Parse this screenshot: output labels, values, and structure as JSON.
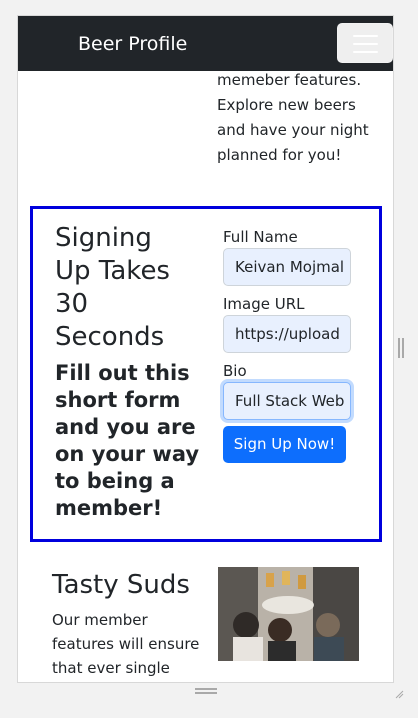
{
  "navbar": {
    "brand": "Beer Profile",
    "toggler_label": "Toggle navigation"
  },
  "intro": {
    "lines": [
      "memeber features.",
      "Explore new beers",
      "and have your night",
      "planned for you!"
    ]
  },
  "signup": {
    "title_lines": [
      "Signing",
      "Up Takes",
      "30",
      "Seconds"
    ],
    "subtitle_lines": [
      "Fill out this",
      "short form",
      "and you are",
      "on your way",
      "to being a",
      "member!"
    ],
    "fields": {
      "full_name": {
        "label": "Full Name",
        "value": "Keivan Mojmal"
      },
      "image_url": {
        "label": "Image URL",
        "value": "https://upload"
      },
      "bio": {
        "label": "Bio",
        "value": "Full Stack Web"
      }
    },
    "submit_label": "Sign Up Now!",
    "border_color": "#0000dd",
    "button_color": "#0d6efd"
  },
  "suds": {
    "title": "Tasty Suds",
    "lines": [
      "Our member",
      "features will ensure",
      "that ever single"
    ],
    "image_icon": "people-toasting-beers-photo"
  },
  "colors": {
    "navbar_bg": "#212529",
    "input_autofill_bg": "#e8f0fe",
    "text": "#212529"
  }
}
